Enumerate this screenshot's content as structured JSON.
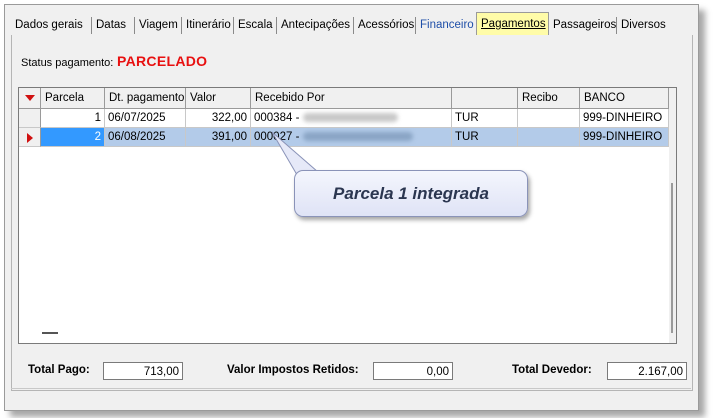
{
  "tabs": [
    {
      "label": "Dados gerais"
    },
    {
      "label": "Datas"
    },
    {
      "label": "Viagem"
    },
    {
      "label": "Itinerário"
    },
    {
      "label": "Escala"
    },
    {
      "label": "Antecipações"
    },
    {
      "label": "Acessórios"
    },
    {
      "label": "Financeiro"
    },
    {
      "label": "Pagamentos"
    },
    {
      "label": "Passageiros"
    },
    {
      "label": "Diversos"
    }
  ],
  "active_tab": "Pagamentos",
  "status": {
    "label": "Status pagamento:",
    "value": "PARCELADO"
  },
  "grid": {
    "columns": [
      "Parcela",
      "Dt. pagamento",
      "Valor",
      "Recebido Por",
      "",
      "Recibo",
      "BANCO"
    ],
    "rows": [
      {
        "parcela": "1",
        "dt_pagamento": "06/07/2025",
        "valor": "322,00",
        "recebido_por": "000384 -",
        "tipo": "TUR",
        "recibo": "",
        "banco": "999-DINHEIRO"
      },
      {
        "parcela": "2",
        "dt_pagamento": "06/08/2025",
        "valor": "391,00",
        "recebido_por": "000027 -",
        "tipo": "TUR",
        "recibo": "",
        "banco": "999-DINHEIRO"
      }
    ],
    "selected_row": 2
  },
  "totals": {
    "total_pago_label": "Total Pago:",
    "total_pago": "713,00",
    "impostos_label": "Valor Impostos Retidos:",
    "impostos": "0,00",
    "devedor_label": "Total Devedor:",
    "devedor": "2.167,00"
  },
  "callout": {
    "text": "Parcela 1 integrada"
  },
  "colors": {
    "status_value": "#e81010",
    "active_tab": "#fffca8",
    "selected_row": "#b3cbe9",
    "focus_cell": "#3399ff",
    "callout_text": "#2b3650"
  }
}
